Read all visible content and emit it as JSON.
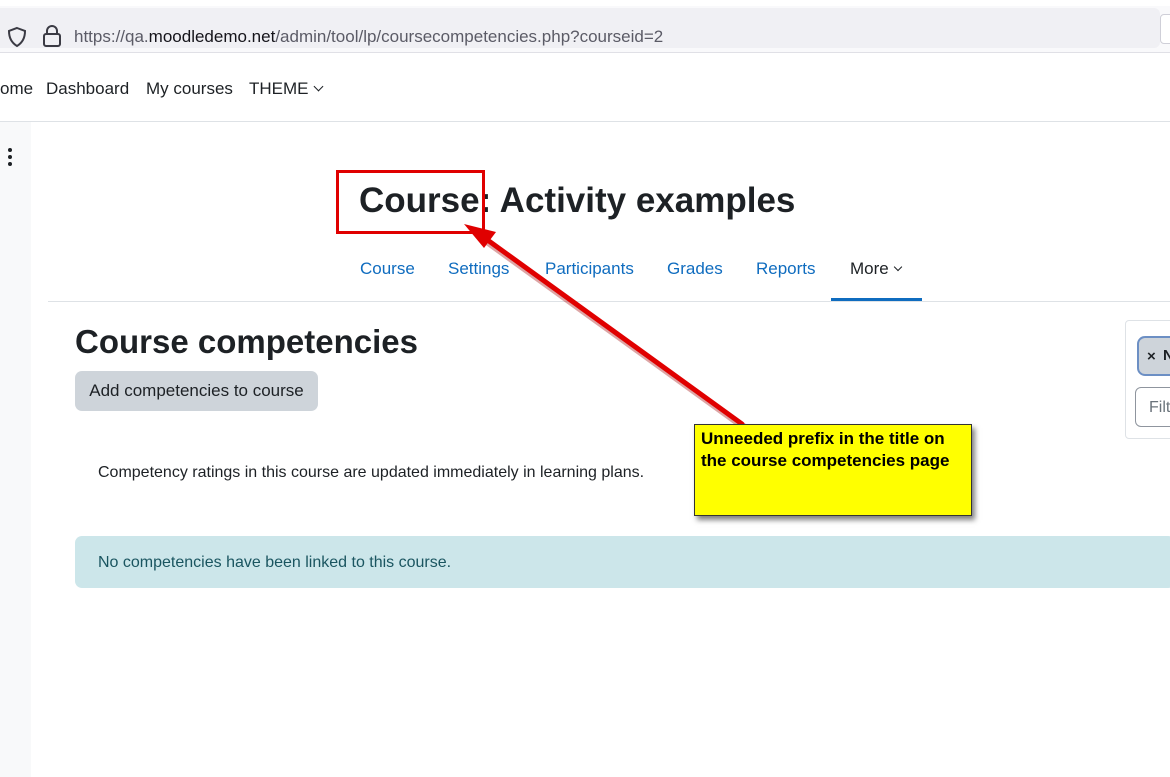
{
  "browser": {
    "url_prefix": "https://qa.",
    "url_host": "moodledemo.net",
    "url_path": "/admin/tool/lp/coursecompetencies.php?courseid=2"
  },
  "topnav": {
    "home": "ome",
    "dashboard": "Dashboard",
    "my_courses": "My courses",
    "theme": "THEME"
  },
  "header": {
    "course_title": "Course: Activity examples"
  },
  "secondary_nav": [
    {
      "label": "Course"
    },
    {
      "label": "Settings"
    },
    {
      "label": "Participants"
    },
    {
      "label": "Grades"
    },
    {
      "label": "Reports"
    },
    {
      "label": "More",
      "active": true
    }
  ],
  "main": {
    "heading": "Course competencies",
    "add_button": "Add competencies to course",
    "info_text": "Competency ratings in this course are updated immediately in learning plans.",
    "alert_text": "No competencies have been linked to this course."
  },
  "filter": {
    "chip_close": "×",
    "chip_text": "N",
    "placeholder": "Filt"
  },
  "annotation": {
    "callout_text": "Unneeded prefix in the title on the course competencies page",
    "color_box": "#e00000",
    "color_callout": "#ffff00"
  },
  "colors": {
    "link": "#0f6cbf",
    "alert_bg": "#cce6ea"
  }
}
